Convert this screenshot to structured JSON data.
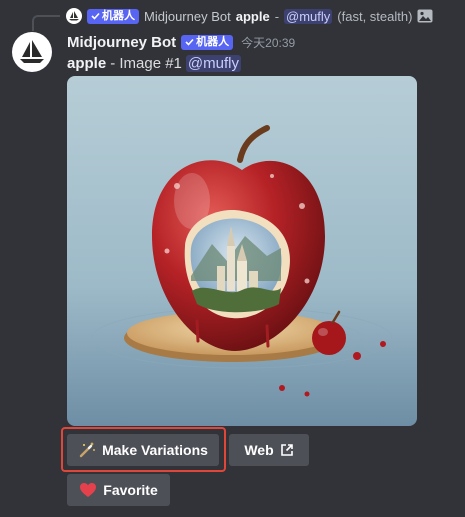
{
  "reply": {
    "bot_tag": "机器人",
    "author": "Midjourney Bot",
    "prompt_bold": "apple",
    "dash": "-",
    "mention": "@mufly",
    "suffix": "(fast, stealth)",
    "image_icon": "image-icon"
  },
  "message": {
    "author": "Midjourney Bot",
    "bot_tag": "机器人",
    "timestamp": "今天20:39",
    "prompt_bold": "apple",
    "text": "- Image #1",
    "mention": "@mufly"
  },
  "buttons": {
    "make_variations": "Make Variations",
    "web": "Web",
    "favorite": "Favorite"
  },
  "icons": {
    "variations": "magic-wand-icon",
    "web": "external-link-icon",
    "favorite": "heart-icon",
    "verified": "checkmark-icon"
  },
  "colors": {
    "background": "#313338",
    "bot_tag": "#5865f2",
    "button": "#4e5058",
    "highlight": "#e0473a",
    "heart": "#e5414d"
  }
}
